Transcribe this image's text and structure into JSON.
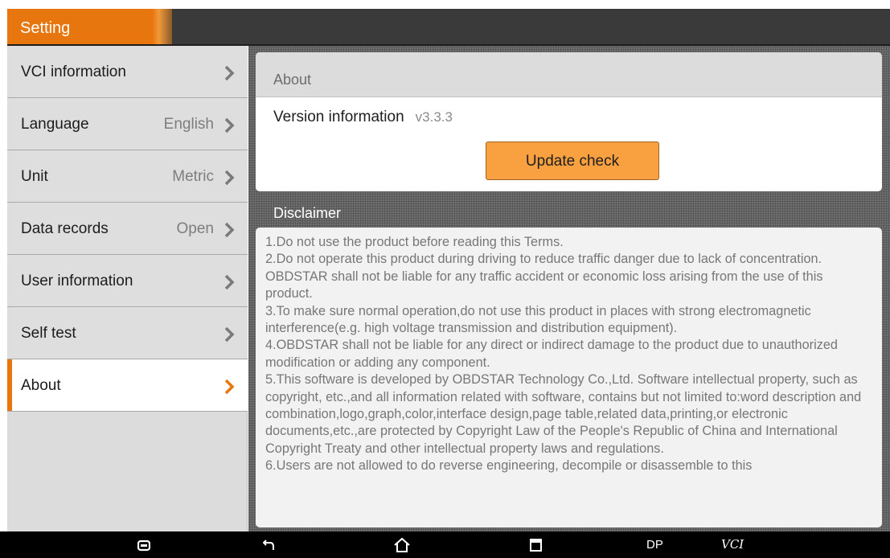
{
  "header": {
    "title": "Setting"
  },
  "sidebar": {
    "items": [
      {
        "label": "VCI information",
        "value": ""
      },
      {
        "label": "Language",
        "value": "English"
      },
      {
        "label": "Unit",
        "value": "Metric"
      },
      {
        "label": "Data records",
        "value": "Open"
      },
      {
        "label": "User information",
        "value": ""
      },
      {
        "label": "Self test",
        "value": ""
      },
      {
        "label": "About",
        "value": "",
        "active": true
      }
    ]
  },
  "about": {
    "heading": "About",
    "version_label": "Version information",
    "version_value": "v3.3.3",
    "update_button": "Update check"
  },
  "disclaimer": {
    "title": "Disclaimer",
    "paragraphs": [
      "1.Do not use the product before reading this Terms.",
      "2.Do not operate this product during driving to reduce traffic danger due to lack of concentration. OBDSTAR shall not be liable for any traffic accident or economic loss arising from the use of this product.",
      "3.To make sure normal operation,do not use this product in places with strong electromagnetic interference(e.g. high voltage transmission and distribution equipment).",
      "4.OBDSTAR shall not be liable for any direct or indirect damage to the product due to unauthorized modification or adding any component.",
      "5.This software is developed by OBDSTAR Technology Co.,Ltd. Software intellectual property, such as copyright, etc.,and all information related with software, contains but not limited to:word description and combination,logo,graph,color,interface design,page table,related data,printing,or electronic documents,etc.,are protected by Copyright Law of the People's Republic of China and International Copyright Treaty and other intellectual property laws and regulations.",
      "6.Users are not allowed to do reverse engineering, decompile or disassemble to this"
    ]
  },
  "navbar": {
    "dp_label": "DP",
    "vci_label": "VCI"
  },
  "colors": {
    "accent": "#e8760e",
    "button": "#f9a040",
    "titlebar": "#3a3a3a"
  }
}
